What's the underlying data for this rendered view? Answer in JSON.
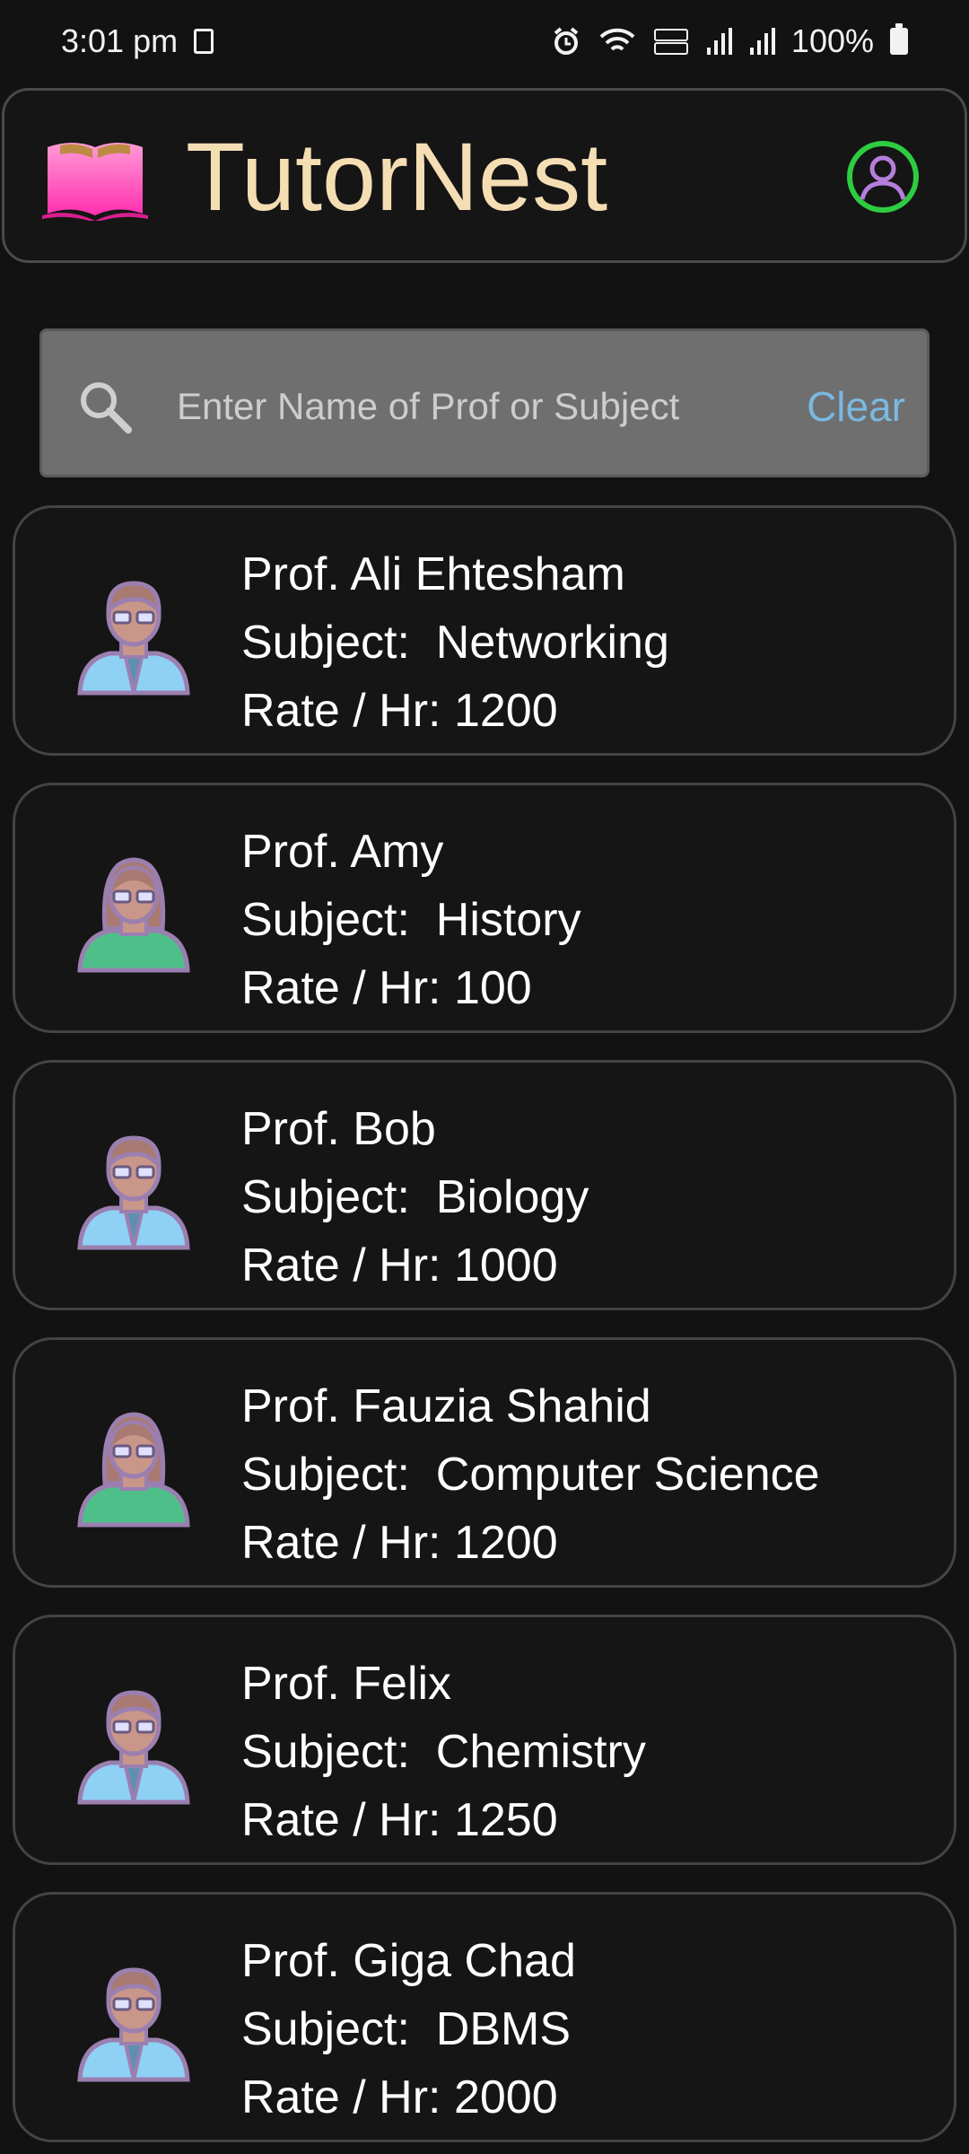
{
  "status_bar": {
    "time": "3:01 pm",
    "battery": "100%",
    "icons": [
      "notification-icon",
      "alarm-icon",
      "wifi-icon",
      "volte-icon",
      "signal-icon",
      "signal-icon",
      "battery-icon"
    ]
  },
  "header": {
    "title": "TutorNest",
    "logo_icon": "open-book-icon",
    "profile_icon": "user-profile-icon",
    "colors": {
      "title": "#f5deb3",
      "logo": "#ff4fbf",
      "profile": "#2ecc40"
    }
  },
  "search": {
    "placeholder": "Enter Name of Prof or Subject",
    "value": "",
    "clear_label": "Clear",
    "icon": "search-icon"
  },
  "tutors": [
    {
      "name": "Prof. Ali Ehtesham",
      "subject_label": "Subject:",
      "subject": "Networking",
      "rate_label": "Rate / Hr:",
      "rate": "1200",
      "avatar": "male-avatar-icon"
    },
    {
      "name": "Prof. Amy",
      "subject_label": "Subject:",
      "subject": "History",
      "rate_label": "Rate / Hr:",
      "rate": "100",
      "avatar": "female-avatar-icon"
    },
    {
      "name": "Prof. Bob",
      "subject_label": "Subject:",
      "subject": "Biology",
      "rate_label": "Rate / Hr:",
      "rate": "1000",
      "avatar": "male-avatar-icon"
    },
    {
      "name": "Prof. Fauzia Shahid",
      "subject_label": "Subject:",
      "subject": "Computer Science",
      "rate_label": "Rate / Hr:",
      "rate": "1200",
      "avatar": "female-avatar-icon"
    },
    {
      "name": "Prof. Felix",
      "subject_label": "Subject:",
      "subject": "Chemistry",
      "rate_label": "Rate / Hr:",
      "rate": "1250",
      "avatar": "male-avatar-icon"
    },
    {
      "name": "Prof. Giga Chad",
      "subject_label": "Subject:",
      "subject": "DBMS",
      "rate_label": "Rate / Hr:",
      "rate": "2000",
      "avatar": "male-avatar-icon"
    }
  ]
}
